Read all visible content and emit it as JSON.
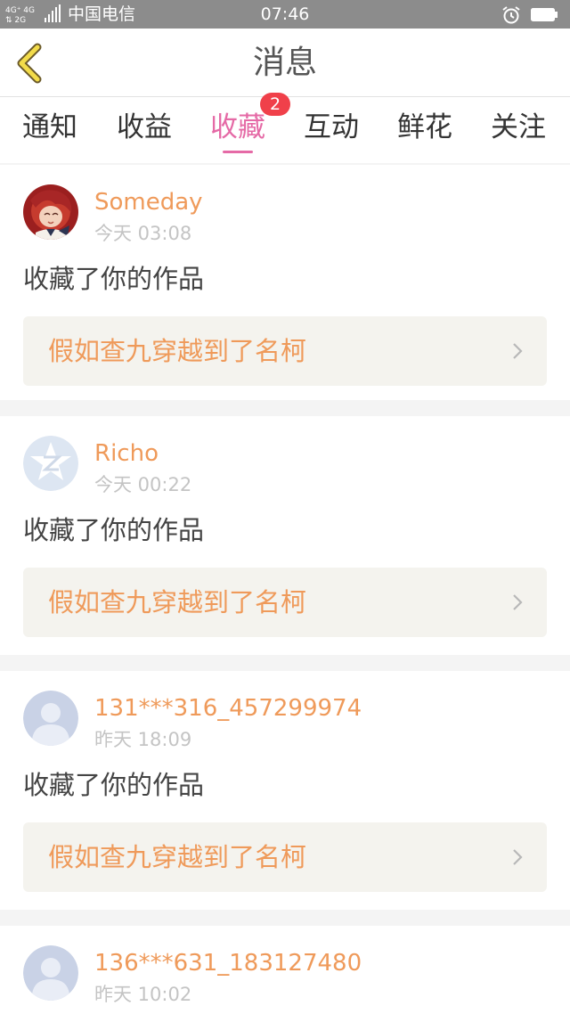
{
  "status_bar": {
    "network": "4G⁺ 4G 2G",
    "carrier": "中国电信",
    "time": "07:46",
    "icons": [
      "signal-icon",
      "alarm-icon",
      "battery-icon"
    ]
  },
  "header": {
    "title": "消息",
    "back_icon": "chevron-left-icon"
  },
  "tabs": [
    {
      "label": "通知"
    },
    {
      "label": "收益"
    },
    {
      "label": "收藏",
      "active": true,
      "badge": "2"
    },
    {
      "label": "互动"
    },
    {
      "label": "鲜花"
    },
    {
      "label": "关注"
    }
  ],
  "messages": [
    {
      "user": "Someday",
      "time": "今天 03:08",
      "action": "收藏了你的作品",
      "work": "假如查九穿越到了名柯",
      "avatar": "anime-avatar"
    },
    {
      "user": "Richo",
      "time": "今天 00:22",
      "action": "收藏了你的作品",
      "work": "假如查九穿越到了名柯",
      "avatar": "qq-default-avatar"
    },
    {
      "user": "131***316_457299974",
      "time": "昨天 18:09",
      "action": "收藏了你的作品",
      "work": "假如查九穿越到了名柯",
      "avatar": "default-person-avatar"
    },
    {
      "user": "136***631_183127480",
      "time": "昨天 10:02",
      "avatar": "default-person-avatar"
    }
  ],
  "colors": {
    "accent": "#e56aa6",
    "username": "#ef9a5a",
    "badge": "#f0404a",
    "status_bar": "#8c8c8c",
    "work_bg": "#f4f3ee"
  }
}
